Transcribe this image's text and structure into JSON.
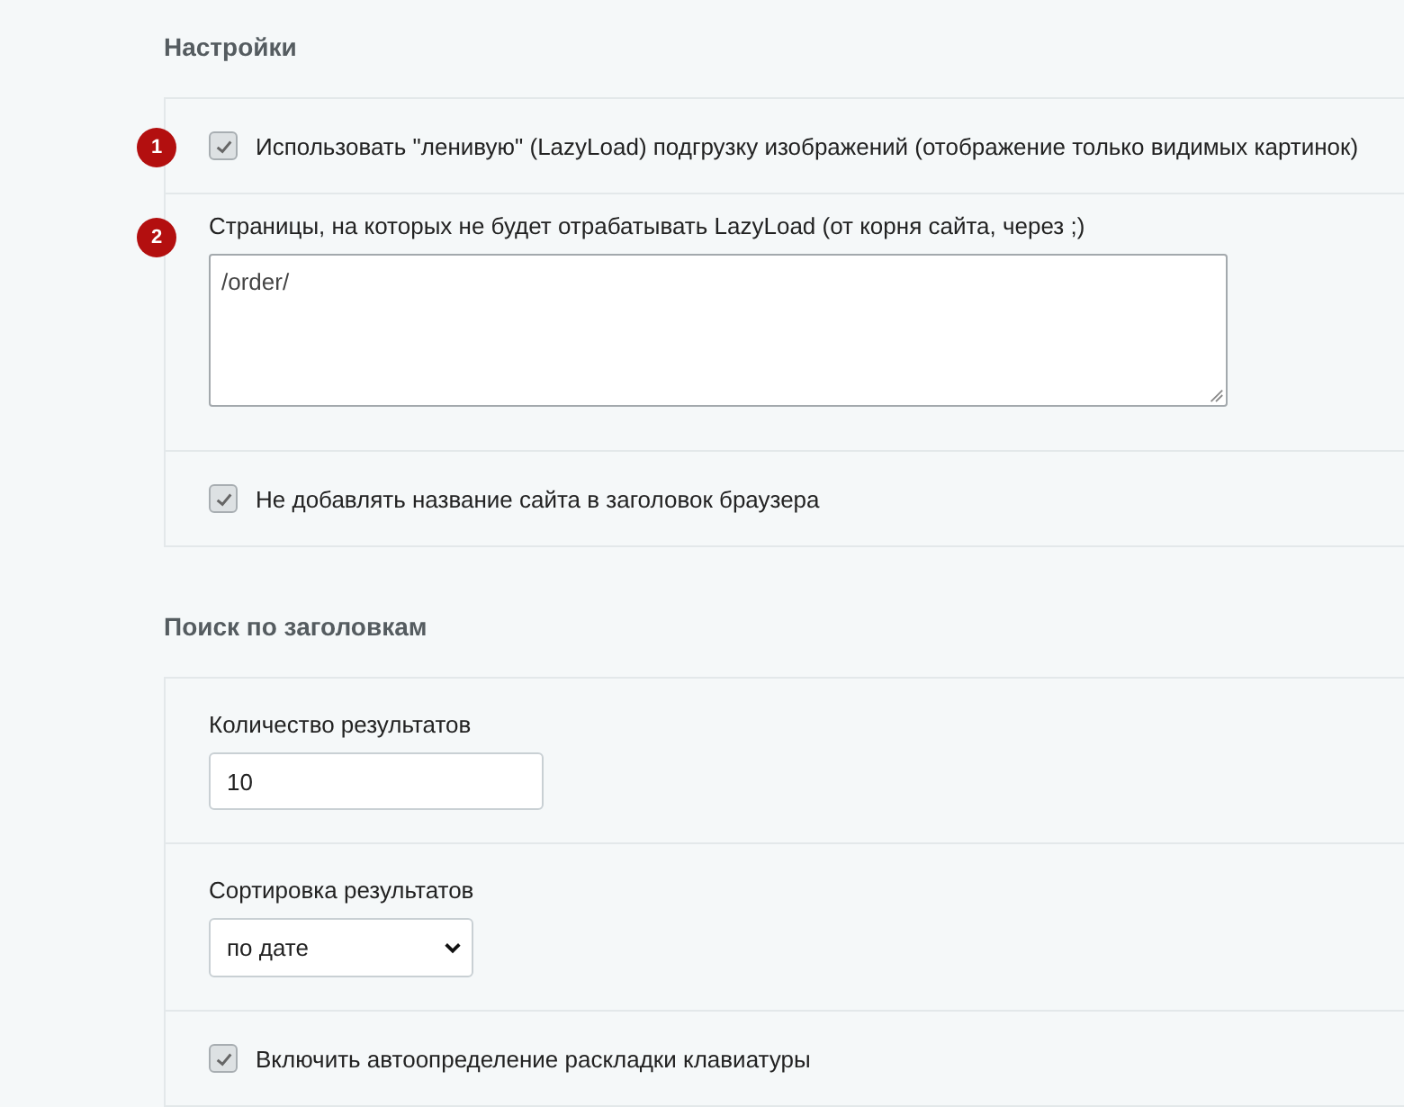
{
  "sections": [
    {
      "title": "Настройки",
      "rows": [
        {
          "kind": "checkbox",
          "badge": "1",
          "label": "Использовать \"ленивую\" (LazyLoad) подгрузку изображений (отображение только видимых картинок)",
          "checked": true
        },
        {
          "kind": "textarea",
          "badge": "2",
          "label": "Страницы, на которых не будет отрабатывать LazyLoad (от корня сайта, через ;)",
          "value": "/order/"
        },
        {
          "kind": "checkbox",
          "label": "Не добавлять название сайта в заголовок браузера",
          "checked": true
        }
      ]
    },
    {
      "title": "Поиск по заголовкам",
      "rows": [
        {
          "kind": "text",
          "label": "Количество результатов",
          "value": "10"
        },
        {
          "kind": "select",
          "label": "Сортировка результатов",
          "value": "по дате"
        },
        {
          "kind": "checkbox",
          "label": "Включить автоопределение раскладки клавиатуры",
          "checked": true
        }
      ]
    }
  ]
}
